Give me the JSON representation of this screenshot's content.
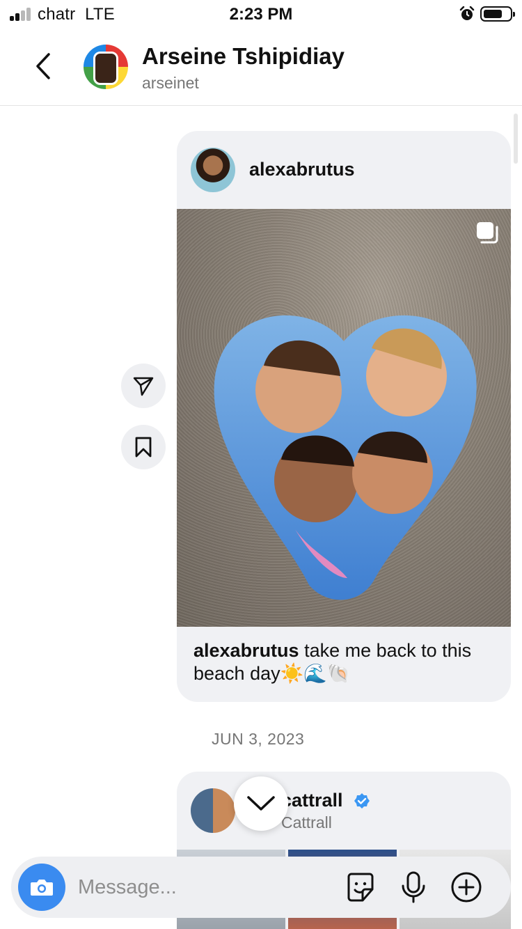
{
  "status_bar": {
    "carrier": "chatr",
    "network": "LTE",
    "time": "2:23 PM",
    "signal_bars_active": 2,
    "signal_bars_total": 4
  },
  "header": {
    "name": "Arseine Tshipidiay",
    "username": "arseinet"
  },
  "messages": [
    {
      "type": "shared_post",
      "author": "alexabrutus",
      "caption_user": "alexabrutus",
      "caption_text": " take me back to this beach day☀️🌊🐚",
      "multi_image": true
    },
    {
      "type": "date_separator",
      "label": "JUN 3, 2023"
    },
    {
      "type": "shared_post",
      "author_visible": "cattrall",
      "subtitle_visible": "Cattrall",
      "verified": true
    }
  ],
  "side_actions": {
    "share_icon": "paper-plane-icon",
    "save_icon": "bookmark-icon"
  },
  "composer": {
    "placeholder": "Message..."
  },
  "colors": {
    "accent": "#3a8bf0",
    "verified": "#3b97f3",
    "bubble": "#f0f1f4"
  }
}
